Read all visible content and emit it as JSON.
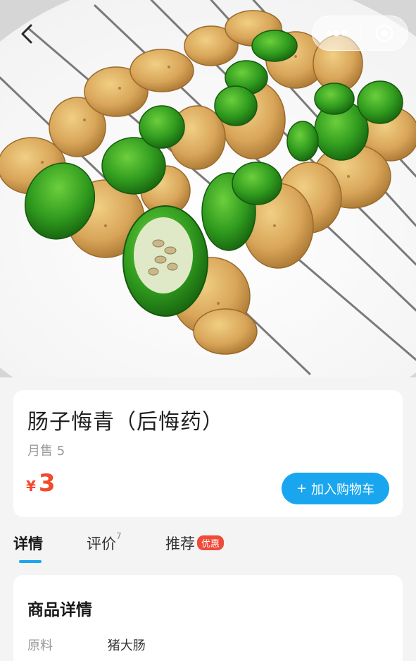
{
  "product": {
    "title": "肠子悔青（后悔药）",
    "sales": "月售 5",
    "currency": "¥",
    "price": "3",
    "add_to_cart": "加入购物车",
    "add_to_cart_icon": "plus-icon"
  },
  "tabs": [
    {
      "label": "详情",
      "active": true
    },
    {
      "label": "评价",
      "count": "7"
    },
    {
      "label": "推荐",
      "badge": "优惠"
    }
  ],
  "details": {
    "title": "商品详情",
    "rows": [
      {
        "key": "原料",
        "value": "猪大肠"
      }
    ]
  },
  "hero": {
    "icons": [
      "chevron-left-icon",
      "more-dots-icon",
      "close-target-icon"
    ]
  },
  "colors": {
    "accent": "#1aa6ef",
    "price": "#f3492c",
    "badge": "#ef4b3a"
  }
}
